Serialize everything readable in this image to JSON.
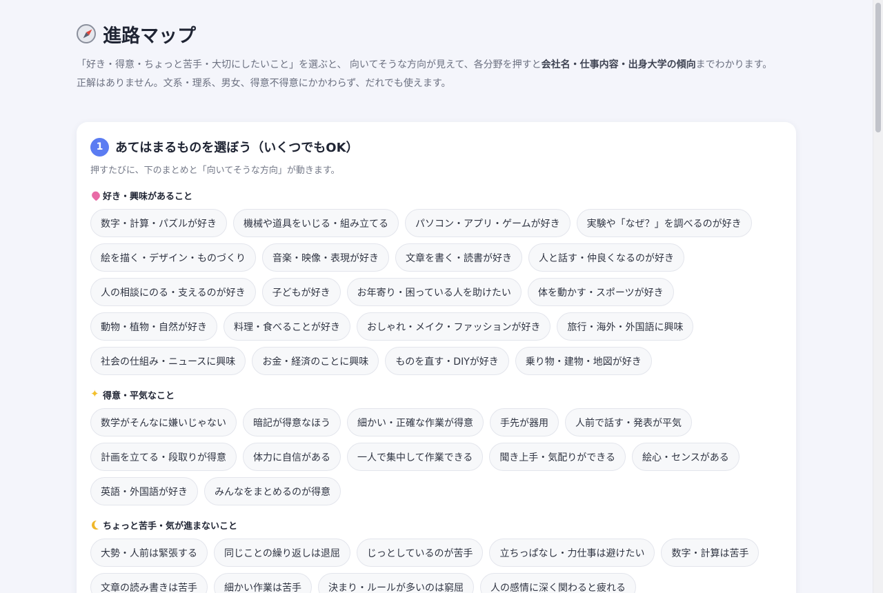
{
  "header": {
    "title": "進路マップ",
    "icon": "compass-icon",
    "intro_part1": "「好き・得意・ちょっと苦手・大切にしたいこと」を選ぶと、 向いてそうな方向が見えて、各分野を押すと",
    "intro_bold": "会社名・仕事内容・出身大学の傾向",
    "intro_part2": "までわかります。",
    "intro_line2": "正解はありません。文系・理系、男女、得意不得意にかかわらず、だれでも使えます。"
  },
  "step1": {
    "number": "1",
    "title": "あてはまるものを選ぼう（いくつでもOK）",
    "subtitle": "押すたびに、下のまとめと「向いてそうな方向」が動きます。",
    "sections": [
      {
        "icon": "heart-icon",
        "label": "好き・興味があること",
        "chips": [
          "数字・計算・パズルが好き",
          "機械や道具をいじる・組み立てる",
          "パソコン・アプリ・ゲームが好き",
          "実験や「なぜ？」を調べるのが好き",
          "絵を描く・デザイン・ものづくり",
          "音楽・映像・表現が好き",
          "文章を書く・読書が好き",
          "人と話す・仲良くなるのが好き",
          "人の相談にのる・支えるのが好き",
          "子どもが好き",
          "お年寄り・困っている人を助けたい",
          "体を動かす・スポーツが好き",
          "動物・植物・自然が好き",
          "料理・食べることが好き",
          "おしゃれ・メイク・ファッションが好き",
          "旅行・海外・外国語に興味",
          "社会の仕組み・ニュースに興味",
          "お金・経済のことに興味",
          "ものを直す・DIYが好き",
          "乗り物・建物・地図が好き"
        ]
      },
      {
        "icon": "sparkle-icon",
        "label": "得意・平気なこと",
        "chips": [
          "数学がそんなに嫌いじゃない",
          "暗記が得意なほう",
          "細かい・正確な作業が得意",
          "手先が器用",
          "人前で話す・発表が平気",
          "計画を立てる・段取りが得意",
          "体力に自信がある",
          "一人で集中して作業できる",
          "聞き上手・気配りができる",
          "絵心・センスがある",
          "英語・外国語が好き",
          "みんなをまとめるのが得意"
        ]
      },
      {
        "icon": "moon-icon",
        "label": "ちょっと苦手・気が進まないこと",
        "chips": [
          "大勢・人前は緊張する",
          "同じことの繰り返しは退屈",
          "じっとしているのが苦手",
          "立ちっぱなし・力仕事は避けたい",
          "数字・計算は苦手",
          "文章の読み書きは苦手",
          "細かい作業は苦手",
          "決まり・ルールが多いのは窮屈",
          "人の感情に深く関わると疲れる"
        ]
      }
    ]
  }
}
